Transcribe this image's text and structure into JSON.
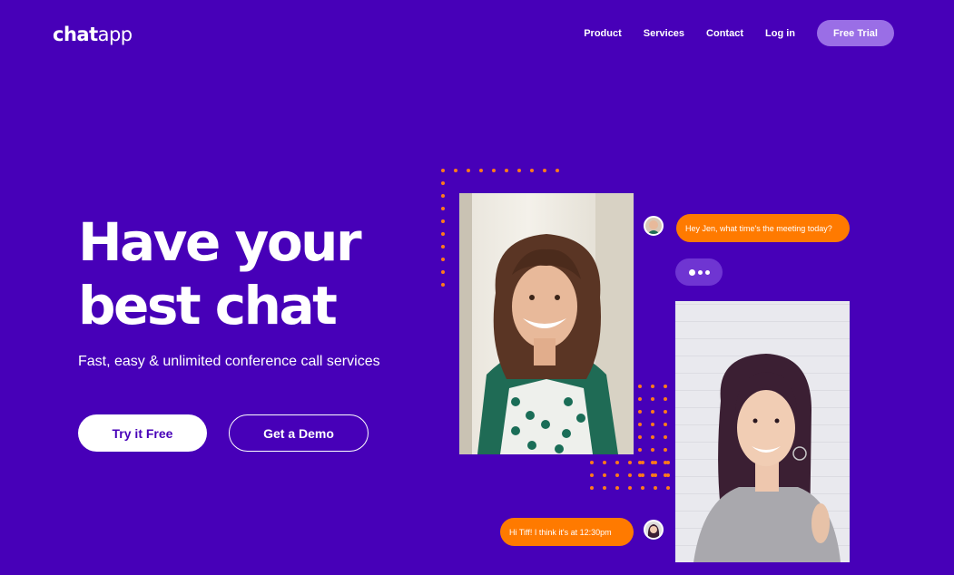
{
  "brand": {
    "logo_bold": "chat",
    "logo_light": "app"
  },
  "nav": {
    "items": [
      {
        "label": "Product"
      },
      {
        "label": "Services"
      },
      {
        "label": "Contact"
      },
      {
        "label": "Log in"
      }
    ],
    "cta": "Free Trial"
  },
  "hero": {
    "title_line1": "Have your",
    "title_line2": "best chat",
    "subtitle": "Fast, easy & unlimited conference call services",
    "primary_cta": "Try it Free",
    "secondary_cta": "Get a Demo"
  },
  "chat": {
    "message_1": "Hey Jen, what time's the meeting today?",
    "message_2": "Hi Tiff! I think it's at 12:30pm"
  },
  "colors": {
    "background": "#4700b8",
    "accent": "#ff7a00",
    "trial_button": "#9a6ee6",
    "white": "#ffffff"
  }
}
